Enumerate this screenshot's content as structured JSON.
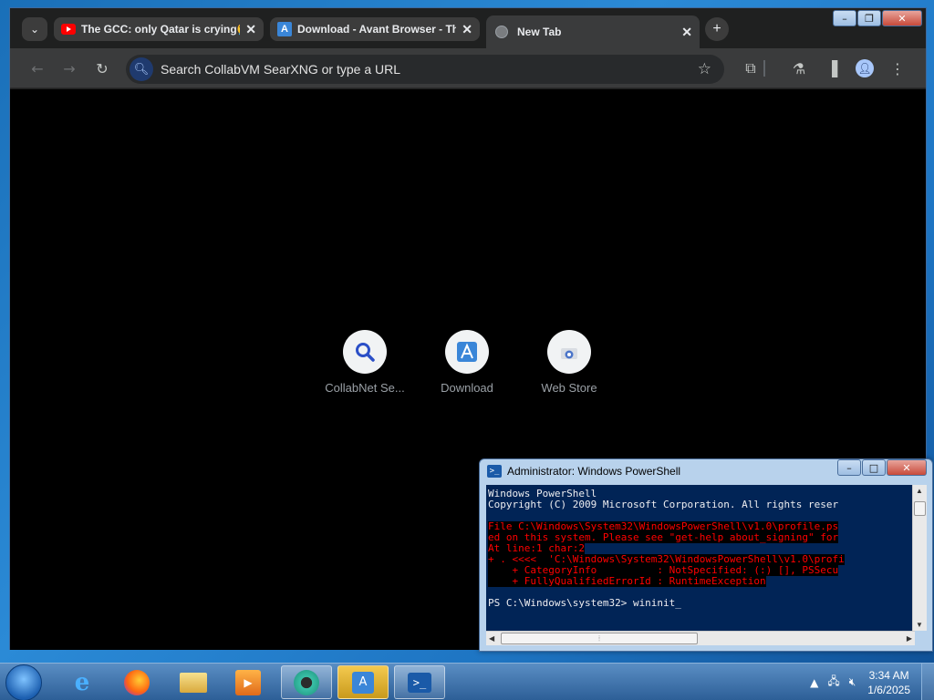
{
  "browser": {
    "tabs": [
      {
        "title": "The GCC: only Qatar is crying😭",
        "icon": "youtube-icon"
      },
      {
        "title": "Download - Avant Browser - Th",
        "icon": "avant-browser-icon"
      },
      {
        "title": "New Tab",
        "icon": "globe-icon",
        "active": true
      }
    ],
    "tab_close": "✕",
    "new_tab": "+",
    "omnibox": {
      "placeholder": "Search CollabVM SearXNG or type a URL"
    },
    "shortcuts": [
      {
        "label": "CollabNet Se...",
        "icon": "search-magnifier-icon"
      },
      {
        "label": "Download",
        "icon": "avant-browser-icon"
      },
      {
        "label": "Web Store",
        "icon": "web-store-icon"
      }
    ],
    "accent": "#a8c7fa"
  },
  "powershell": {
    "title": "Administrator: Windows PowerShell",
    "lines": [
      "Windows PowerShell",
      "Copyright (C) 2009 Microsoft Corporation. All rights reser",
      "",
      "File C:\\Windows\\System32\\WindowsPowerShell\\v1.0\\profile.ps",
      "ed on this system. Please see \"get-help about_signing\" for",
      "At line:1 char:2",
      "+ . <<<<  'C:\\Windows\\System32\\WindowsPowerShell\\v1.0\\profi",
      "    + CategoryInfo          : NotSpecified: (:) [], PSSecu",
      "    + FullyQualifiedErrorId : RuntimeException",
      "",
      "PS C:\\Windows\\system32> wininit_"
    ],
    "error_color": "#ff0000",
    "background": "#012456"
  },
  "taskbar": {
    "time": "3:34 AM",
    "date": "1/6/2025"
  }
}
